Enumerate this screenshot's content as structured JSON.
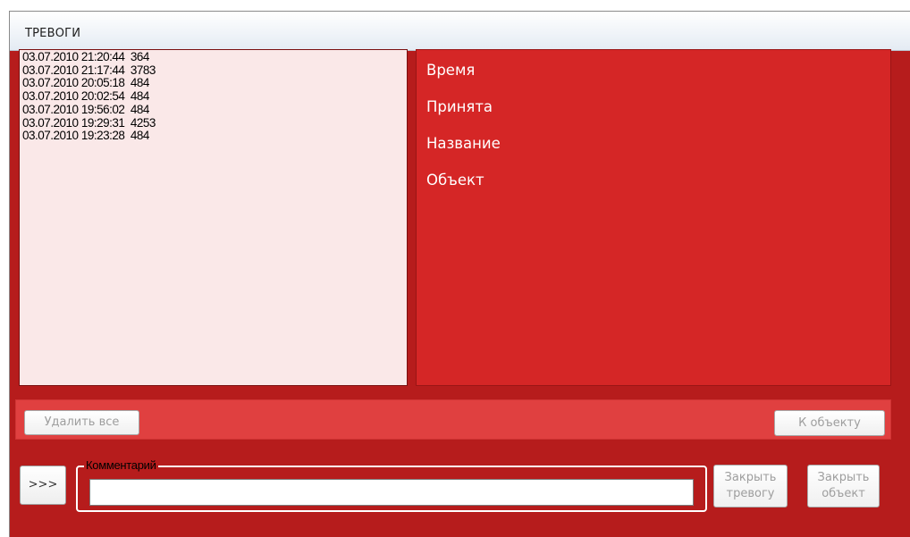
{
  "window": {
    "title": "ТРЕВОГИ"
  },
  "alarm_list": {
    "items": [
      "03.07.2010 21:20:44  364",
      "03.07.2010 21:17:44  3783",
      "03.07.2010 20:05:18  484",
      "03.07.2010 20:02:54  484",
      "03.07.2010 19:56:02  484",
      "03.07.2010 19:29:31  4253",
      "03.07.2010 19:23:28  484"
    ]
  },
  "details": {
    "time_label": "Время",
    "accepted_label": "Принята",
    "name_label": "Название",
    "object_label": "Объект"
  },
  "actions": {
    "delete_all": "Удалить все",
    "to_object": "К объекту"
  },
  "comment": {
    "legend": "Комментарий",
    "value": "",
    "expand_label": ">>>"
  },
  "close_buttons": {
    "close_alarm": "Закрыть тревогу",
    "close_object": "Закрыть объект"
  },
  "colors": {
    "frame": "#b61c1c",
    "detail_panel": "#d52626",
    "action_bar": "#e04040",
    "list_background": "#fae8e8"
  }
}
